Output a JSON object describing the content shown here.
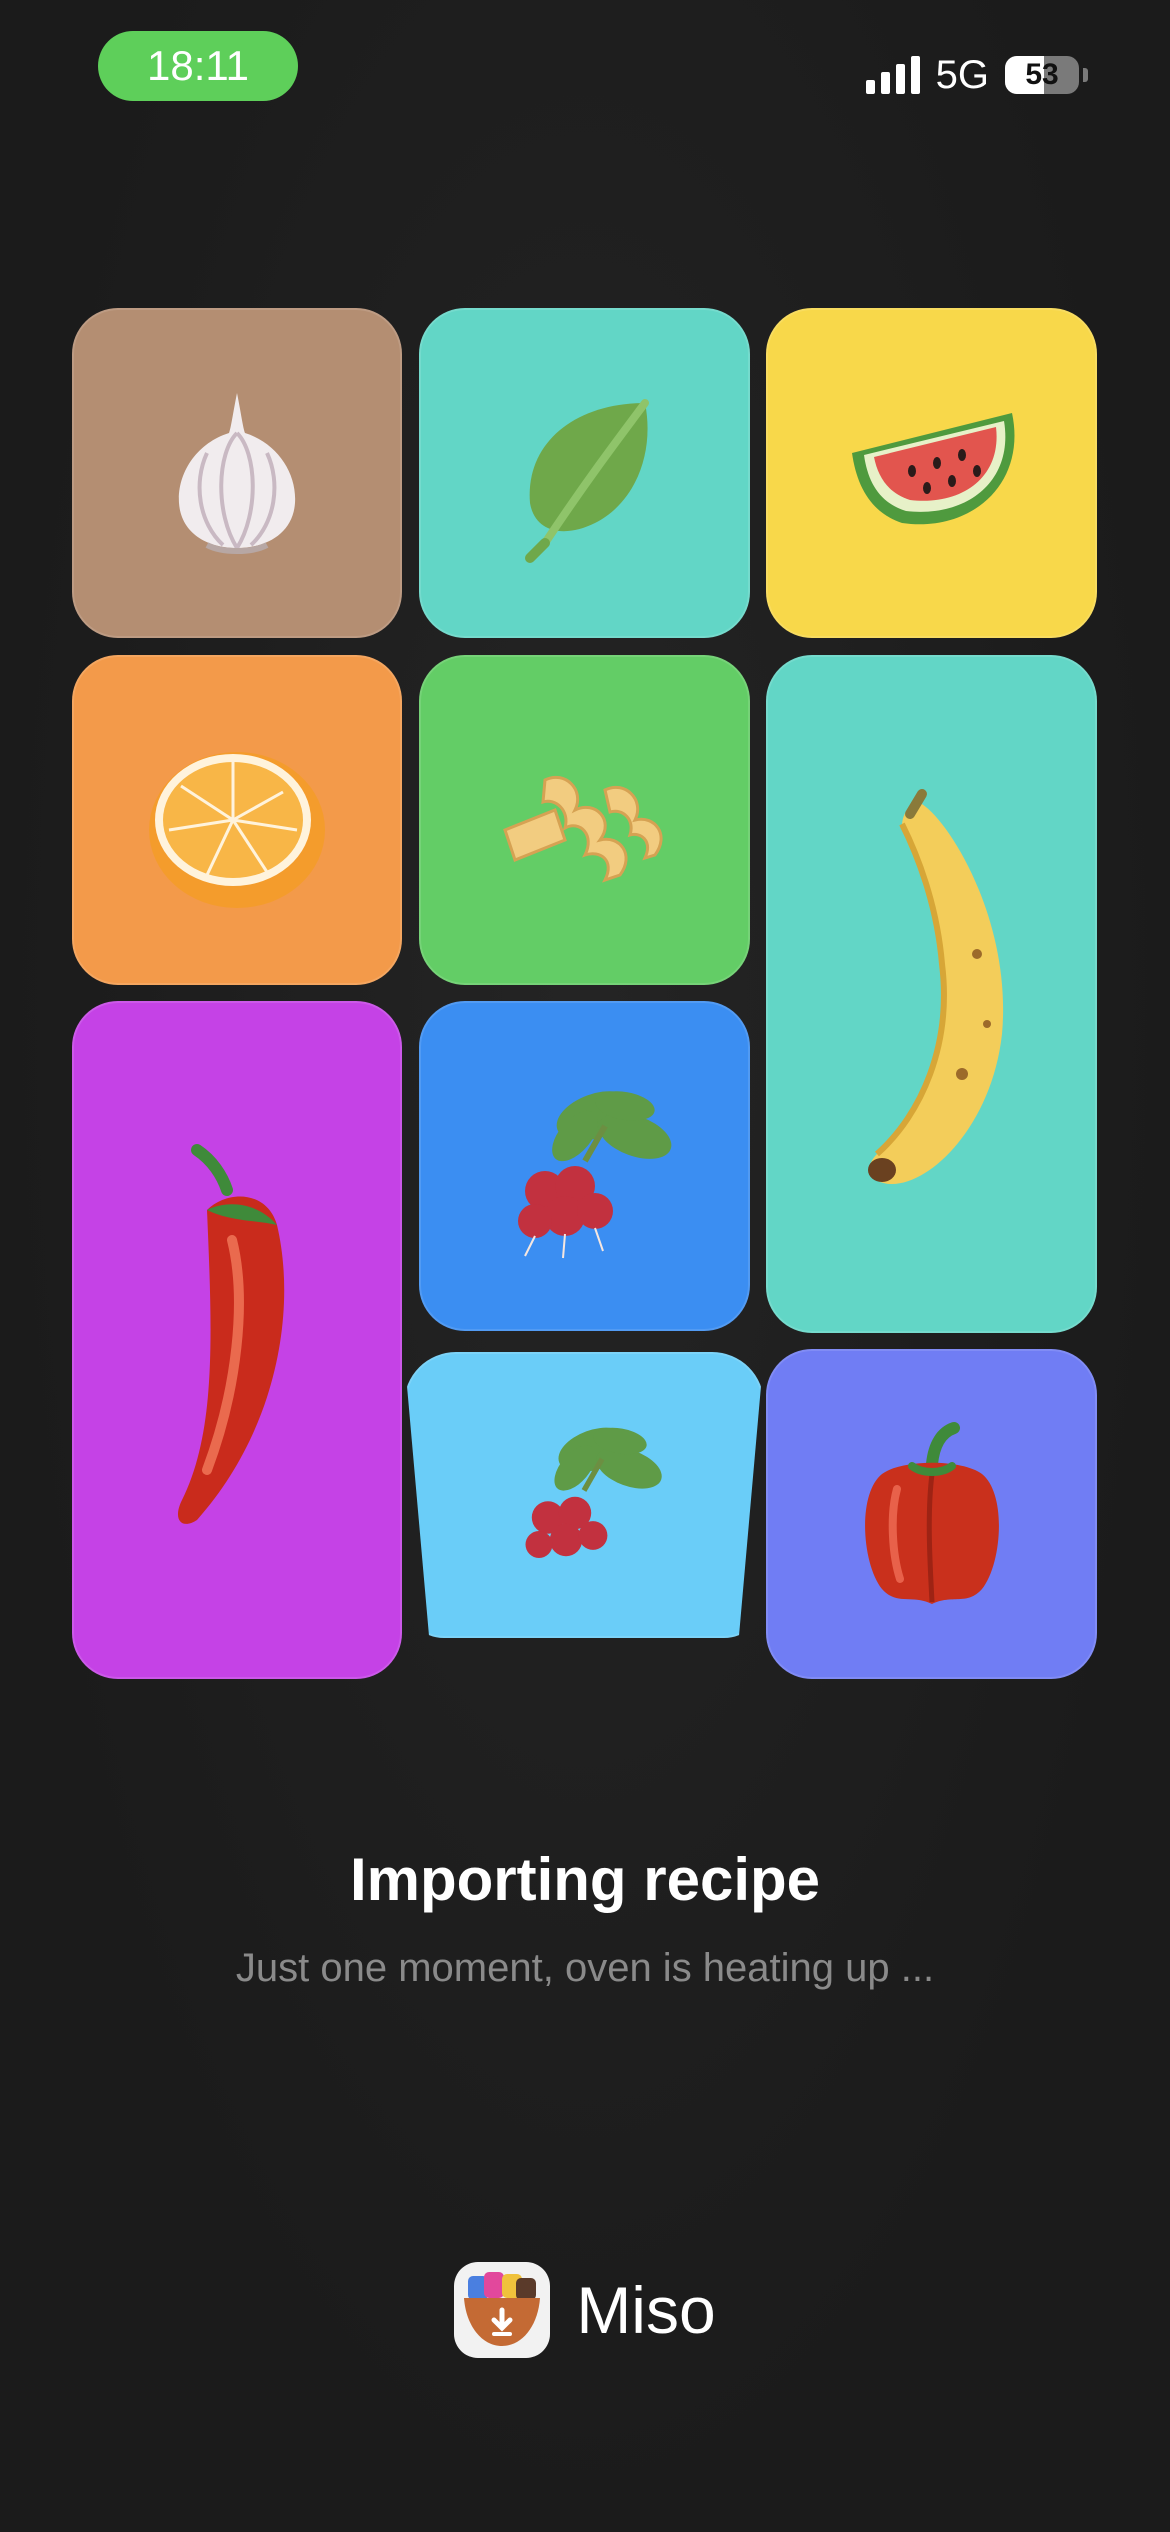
{
  "status_bar": {
    "time": "18:11",
    "network": "5G",
    "battery": "53",
    "battery_level_percent": 53,
    "time_pill_color": "#5ecf5a"
  },
  "tiles": [
    {
      "name": "garlic",
      "icon": "garlic-icon",
      "color": "#b48e72"
    },
    {
      "name": "basil-leaf",
      "icon": "leaf-icon",
      "color": "#62d6c6"
    },
    {
      "name": "watermelon",
      "icon": "watermelon-icon",
      "color": "#f8d84a"
    },
    {
      "name": "orange",
      "icon": "orange-icon",
      "color": "#f39a4a"
    },
    {
      "name": "pasta",
      "icon": "pasta-icon",
      "color": "#63cd66"
    },
    {
      "name": "banana",
      "icon": "banana-icon",
      "color": "#62d6c6"
    },
    {
      "name": "chili-pepper",
      "icon": "chili-icon",
      "color": "#c542e6"
    },
    {
      "name": "radish",
      "icon": "radish-icon",
      "color": "#3b8ef2"
    },
    {
      "name": "radish-2",
      "icon": "radish-icon",
      "color": "#6acdf8"
    },
    {
      "name": "bell-pepper",
      "icon": "bell-pepper-icon",
      "color": "#707df4"
    }
  ],
  "loading": {
    "title": "Importing recipe",
    "subtitle": "Just one moment, oven is heating up ..."
  },
  "brand": {
    "name": "Miso",
    "icon": "miso-app-icon"
  }
}
